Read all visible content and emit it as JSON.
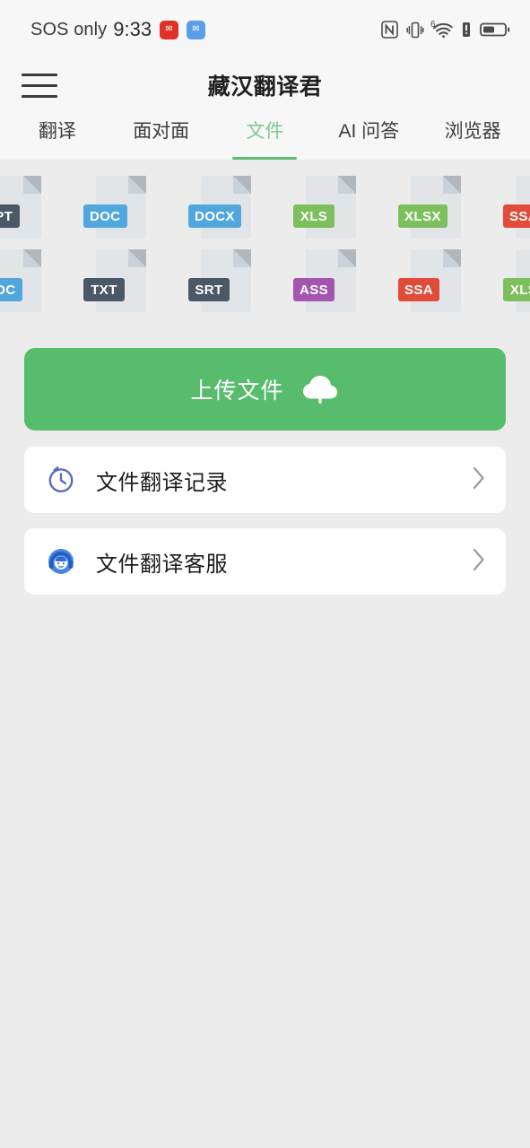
{
  "statusbar": {
    "carrier": "SOS only",
    "time": "9:33",
    "notif_icons": [
      {
        "name": "app-notification-red",
        "color": "#e03127",
        "glyph": "✉"
      },
      {
        "name": "app-notification-blue",
        "color": "#5a9ee8",
        "glyph": "✉"
      }
    ],
    "right_icons": [
      "nfc-icon",
      "vibrate-icon",
      "wifi6-icon",
      "alert-icon",
      "battery-icon"
    ],
    "wifi_superscript": "6"
  },
  "appbar": {
    "menu_icon": "hamburger-menu-icon",
    "title": "藏汉翻译君"
  },
  "tabs": {
    "active_index": 2,
    "accent": "#5cbb6e",
    "active_text_color": "#7ec98b",
    "items": [
      {
        "label": "翻译"
      },
      {
        "label": "面对面"
      },
      {
        "label": "文件"
      },
      {
        "label": "AI 问答"
      },
      {
        "label": "浏览器"
      }
    ]
  },
  "filetypes": {
    "row1": [
      {
        "label": "PPT",
        "color": "#4b5966"
      },
      {
        "label": "DOC",
        "color": "#50a6dd"
      },
      {
        "label": "DOCX",
        "color": "#50a6dd"
      },
      {
        "label": "XLS",
        "color": "#7dbf5c"
      },
      {
        "label": "XLSX",
        "color": "#7dbf5c"
      },
      {
        "label": "SSA",
        "color": "#e04b3a"
      }
    ],
    "row2": [
      {
        "label": "DOC",
        "color": "#50a6dd"
      },
      {
        "label": "TXT",
        "color": "#4b5966"
      },
      {
        "label": "SRT",
        "color": "#4b5966"
      },
      {
        "label": "ASS",
        "color": "#a355b0"
      },
      {
        "label": "SSA",
        "color": "#e04b3a"
      },
      {
        "label": "XLS",
        "color": "#7dbf5c"
      }
    ]
  },
  "upload": {
    "label": "上传文件",
    "icon": "cloud-upload-icon",
    "bg_color": "#57bc6c"
  },
  "cards": [
    {
      "label": "文件翻译记录",
      "icon": "history-clock-icon",
      "icon_color": "#5b6cc4",
      "chevron": "chevron-right-icon"
    },
    {
      "label": "文件翻译客服",
      "icon": "customer-service-icon",
      "icon_color": "#3f7fe0",
      "chevron": "chevron-right-icon"
    }
  ]
}
